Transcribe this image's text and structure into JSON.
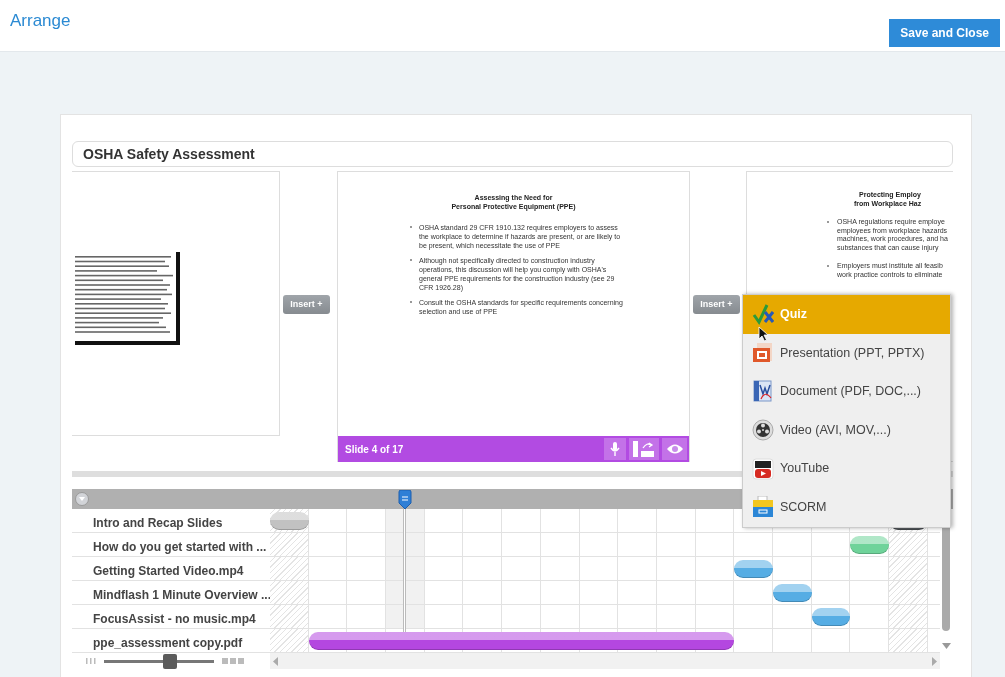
{
  "header": {
    "title": "Arrange",
    "save_button": "Save and Close"
  },
  "course_title": "OSHA Safety Assessment",
  "slides": [
    {
      "kind": "thumbnail"
    },
    {
      "kind": "full",
      "title_lines": [
        "Assessing the Need for",
        "Personal Protective Equipment (PPE)"
      ],
      "bullets": [
        "OSHA standard 29 CFR 1910.132 requires employers to assess the workplace to determine if hazards are present, or are likely to be present, which necessitate the use of PPE",
        "Although not specifically directed to construction industry operations, this discussion will help you comply with OSHA's general PPE requirements for the construction industry (see 29 CFR 1926.28)",
        "Consult the OSHA standards for specific requirements concerning selection and use of PPE"
      ],
      "footer": "Slide 4 of 17"
    },
    {
      "kind": "cut",
      "title_lines": [
        "Protecting Employ",
        "from Workplace Haz"
      ],
      "bullets": [
        [
          "OSHA regulations require employe",
          "employees from workplace hazards",
          "machines, work procedures, and ha",
          "substances that can cause injury"
        ],
        [
          "Employers must institute all feasib",
          "work practice controls to eliminate"
        ]
      ]
    }
  ],
  "insert_buttons": [
    "Insert +",
    "Insert +"
  ],
  "insert_menu": [
    {
      "kind": "quiz",
      "label": "Quiz",
      "selected": true
    },
    {
      "kind": "presentation",
      "label": "Presentation (PPT, PPTX)",
      "selected": false
    },
    {
      "kind": "document",
      "label": "Document (PDF, DOC,...)",
      "selected": false
    },
    {
      "kind": "video",
      "label": "Video (AVI, MOV,...)",
      "selected": false
    },
    {
      "kind": "youtube",
      "label": "YouTube",
      "selected": false
    },
    {
      "kind": "scorm",
      "label": "SCORM",
      "selected": false
    }
  ],
  "timeline": {
    "rows": [
      {
        "label": "Intro and Recap Slides",
        "cells": [
          {
            "kind": "hatched",
            "bar": {
              "color": "#c2c2c2"
            }
          },
          {
            "kind": "plain"
          },
          {
            "kind": "plain"
          },
          {
            "kind": "current"
          },
          {
            "kind": "plain"
          },
          {
            "kind": "plain"
          },
          {
            "kind": "plain"
          },
          {
            "kind": "plain"
          },
          {
            "kind": "plain"
          },
          {
            "kind": "plain"
          },
          {
            "kind": "plain"
          },
          {
            "kind": "plain"
          },
          {
            "kind": "plain"
          },
          {
            "kind": "plain"
          },
          {
            "kind": "plain"
          },
          {
            "kind": "plain"
          },
          {
            "kind": "hatched",
            "bar": {
              "color": "#55595e"
            }
          }
        ]
      },
      {
        "label": "How do you get started with ...",
        "cells": [
          {
            "kind": "hatched"
          },
          {
            "kind": "plain"
          },
          {
            "kind": "plain"
          },
          {
            "kind": "current"
          },
          {
            "kind": "plain"
          },
          {
            "kind": "plain"
          },
          {
            "kind": "plain"
          },
          {
            "kind": "plain"
          },
          {
            "kind": "plain"
          },
          {
            "kind": "plain"
          },
          {
            "kind": "plain"
          },
          {
            "kind": "plain"
          },
          {
            "kind": "plain"
          },
          {
            "kind": "plain"
          },
          {
            "kind": "plain"
          },
          {
            "kind": "plain",
            "bar": {
              "color": "#6fd39a"
            }
          },
          {
            "kind": "hatched"
          }
        ]
      },
      {
        "label": "Getting Started Video.mp4",
        "cells": [
          {
            "kind": "hatched"
          },
          {
            "kind": "plain"
          },
          {
            "kind": "plain"
          },
          {
            "kind": "current"
          },
          {
            "kind": "plain"
          },
          {
            "kind": "plain"
          },
          {
            "kind": "plain"
          },
          {
            "kind": "plain"
          },
          {
            "kind": "plain"
          },
          {
            "kind": "plain"
          },
          {
            "kind": "plain"
          },
          {
            "kind": "plain"
          },
          {
            "kind": "plain",
            "bar": {
              "color": "#56ade4"
            }
          },
          {
            "kind": "plain"
          },
          {
            "kind": "plain"
          },
          {
            "kind": "plain"
          },
          {
            "kind": "hatched"
          }
        ]
      },
      {
        "label": "Mindflash 1 Minute Overview ...",
        "cells": [
          {
            "kind": "hatched"
          },
          {
            "kind": "plain"
          },
          {
            "kind": "plain"
          },
          {
            "kind": "current"
          },
          {
            "kind": "plain"
          },
          {
            "kind": "plain"
          },
          {
            "kind": "plain"
          },
          {
            "kind": "plain"
          },
          {
            "kind": "plain"
          },
          {
            "kind": "plain"
          },
          {
            "kind": "plain"
          },
          {
            "kind": "plain"
          },
          {
            "kind": "plain"
          },
          {
            "kind": "plain",
            "bar": {
              "color": "#56ade4"
            }
          },
          {
            "kind": "plain"
          },
          {
            "kind": "plain"
          },
          {
            "kind": "hatched"
          }
        ]
      },
      {
        "label": "FocusAssist - no music.mp4",
        "cells": [
          {
            "kind": "hatched"
          },
          {
            "kind": "plain"
          },
          {
            "kind": "plain"
          },
          {
            "kind": "current"
          },
          {
            "kind": "plain"
          },
          {
            "kind": "plain"
          },
          {
            "kind": "plain"
          },
          {
            "kind": "plain"
          },
          {
            "kind": "plain"
          },
          {
            "kind": "plain"
          },
          {
            "kind": "plain"
          },
          {
            "kind": "plain"
          },
          {
            "kind": "plain"
          },
          {
            "kind": "plain"
          },
          {
            "kind": "plain",
            "bar": {
              "color": "#56ade4"
            }
          },
          {
            "kind": "plain"
          },
          {
            "kind": "hatched"
          }
        ]
      },
      {
        "label": "ppe_assessment copy.pdf",
        "cells": [
          {
            "kind": "hatched"
          },
          {
            "kind": "plain",
            "bar": {
              "color": "#b447e0"
            }
          },
          {
            "kind": "plain",
            "bar": {
              "color": "#b447e0",
              "joined": true
            }
          },
          {
            "kind": "plain",
            "bar": {
              "color": "#b447e0",
              "joined": true
            }
          },
          {
            "kind": "plain",
            "bar": {
              "color": "#b447e0",
              "joined": true
            }
          },
          {
            "kind": "plain",
            "bar": {
              "color": "#b447e0",
              "joined": true
            }
          },
          {
            "kind": "plain",
            "bar": {
              "color": "#b447e0",
              "joined": true
            }
          },
          {
            "kind": "plain",
            "bar": {
              "color": "#b447e0",
              "joined": true
            }
          },
          {
            "kind": "plain",
            "bar": {
              "color": "#b447e0",
              "joined": true
            }
          },
          {
            "kind": "plain",
            "bar": {
              "color": "#b447e0",
              "joined": true
            }
          },
          {
            "kind": "plain",
            "bar": {
              "color": "#b447e0",
              "joined": true
            }
          },
          {
            "kind": "plain",
            "bar": {
              "color": "#b447e0",
              "joined": true
            }
          },
          {
            "kind": "plain"
          },
          {
            "kind": "plain"
          },
          {
            "kind": "plain"
          },
          {
            "kind": "plain"
          },
          {
            "kind": "hatched"
          }
        ]
      }
    ]
  },
  "zoom_slider": {
    "level": 0.6
  }
}
